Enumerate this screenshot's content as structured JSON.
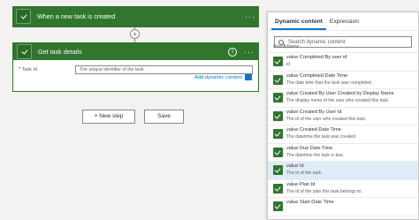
{
  "flow": {
    "trigger_title": "When a new task is created",
    "action_title": "Get task details",
    "field_label": "Task Id",
    "field_required": "*",
    "field_placeholder": "The unique identifier of the task.",
    "add_dynamic_label": "Add dynamic content",
    "new_step_label": "+ New step",
    "save_label": "Save",
    "ellipsis": "···",
    "info": "i"
  },
  "panel": {
    "tabs": [
      "Dynamic content",
      "Expression"
    ],
    "search_placeholder": "Search dynamic content",
    "items": [
      {
        "name": "",
        "desc": "displayName"
      },
      {
        "name": "value Completed By user id",
        "desc": "id"
      },
      {
        "name": "value Completed Date Time",
        "desc": "The date time that the task was completed."
      },
      {
        "name": "value Created By User Created by Display Name",
        "desc": "The display name of the user who created this task."
      },
      {
        "name": "value Created By User Id",
        "desc": "The id of the user who created this task."
      },
      {
        "name": "value Created Date Time",
        "desc": "The datetime the task was created."
      },
      {
        "name": "value Due Date Time",
        "desc": "The datetime the task is due."
      },
      {
        "name": "value Id",
        "desc": "The id of the task."
      },
      {
        "name": "value Plan Id",
        "desc": "The id of the plan this task belongs to."
      },
      {
        "name": "value Start Date Time",
        "desc": ""
      }
    ]
  },
  "colors": {
    "accent": "#31752f",
    "link": "#0078d4"
  }
}
